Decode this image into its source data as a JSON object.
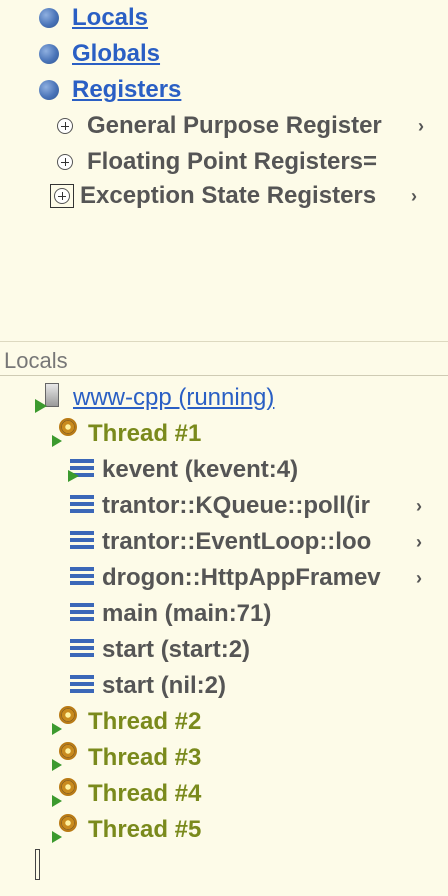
{
  "variables_tree": {
    "sections": [
      {
        "label": "Locals",
        "icon": "blue-ball-icon"
      },
      {
        "label": "Globals",
        "icon": "blue-ball-icon"
      },
      {
        "label": "Registers",
        "icon": "blue-ball-icon"
      }
    ],
    "registers": [
      {
        "label": "General Purpose Register",
        "has_more": true
      },
      {
        "label": "Floating Point Registers=",
        "has_more": false
      },
      {
        "label": "Exception State Registers",
        "has_more": true
      }
    ]
  },
  "locals_panel": {
    "header": "Locals",
    "process": {
      "label": "www-cpp (running)",
      "icon": "server-icon"
    },
    "threads": [
      {
        "label": "Thread #1",
        "frames": [
          {
            "label": "kevent (kevent:4)",
            "current": true,
            "has_more": false
          },
          {
            "label": "trantor::KQueue::poll(ir",
            "current": false,
            "has_more": true
          },
          {
            "label": "trantor::EventLoop::loo",
            "current": false,
            "has_more": true
          },
          {
            "label": "drogon::HttpAppFramev",
            "current": false,
            "has_more": true
          },
          {
            "label": "main (main:71)",
            "current": false,
            "has_more": false
          },
          {
            "label": "start (start:2)",
            "current": false,
            "has_more": false
          },
          {
            "label": "start (nil:2)",
            "current": false,
            "has_more": false
          }
        ]
      },
      {
        "label": "Thread #2"
      },
      {
        "label": "Thread #3"
      },
      {
        "label": "Thread #4"
      },
      {
        "label": "Thread #5"
      }
    ],
    "more_arrow": "›"
  },
  "colors": {
    "background": "#fdfbe8",
    "link": "#2a5fc4",
    "thread_text": "#7a8a1c",
    "frame_icon": "#3b67b8"
  }
}
